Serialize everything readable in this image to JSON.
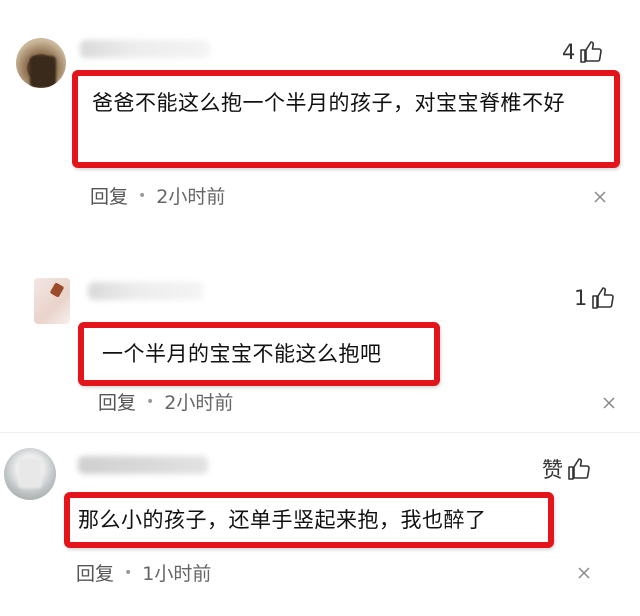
{
  "comments": [
    {
      "likes": "4",
      "text": "爸爸不能这么抱一个半月的孩子，对宝宝脊椎不好",
      "reply_label": "回复",
      "time": "2小时前"
    },
    {
      "likes": "1",
      "text": "一个半月的宝宝不能这么抱吧",
      "reply_label": "回复",
      "time": "2小时前"
    },
    {
      "likes": "赞",
      "text": "那么小的孩子，还单手竖起来抱，我也醉了",
      "reply_label": "回复",
      "time": "1小时前"
    }
  ],
  "colors": {
    "highlight_border": "#e3141a",
    "meta_text": "#555555"
  },
  "icons": {
    "like": "thumbs-up-icon",
    "dismiss": "close-icon"
  }
}
